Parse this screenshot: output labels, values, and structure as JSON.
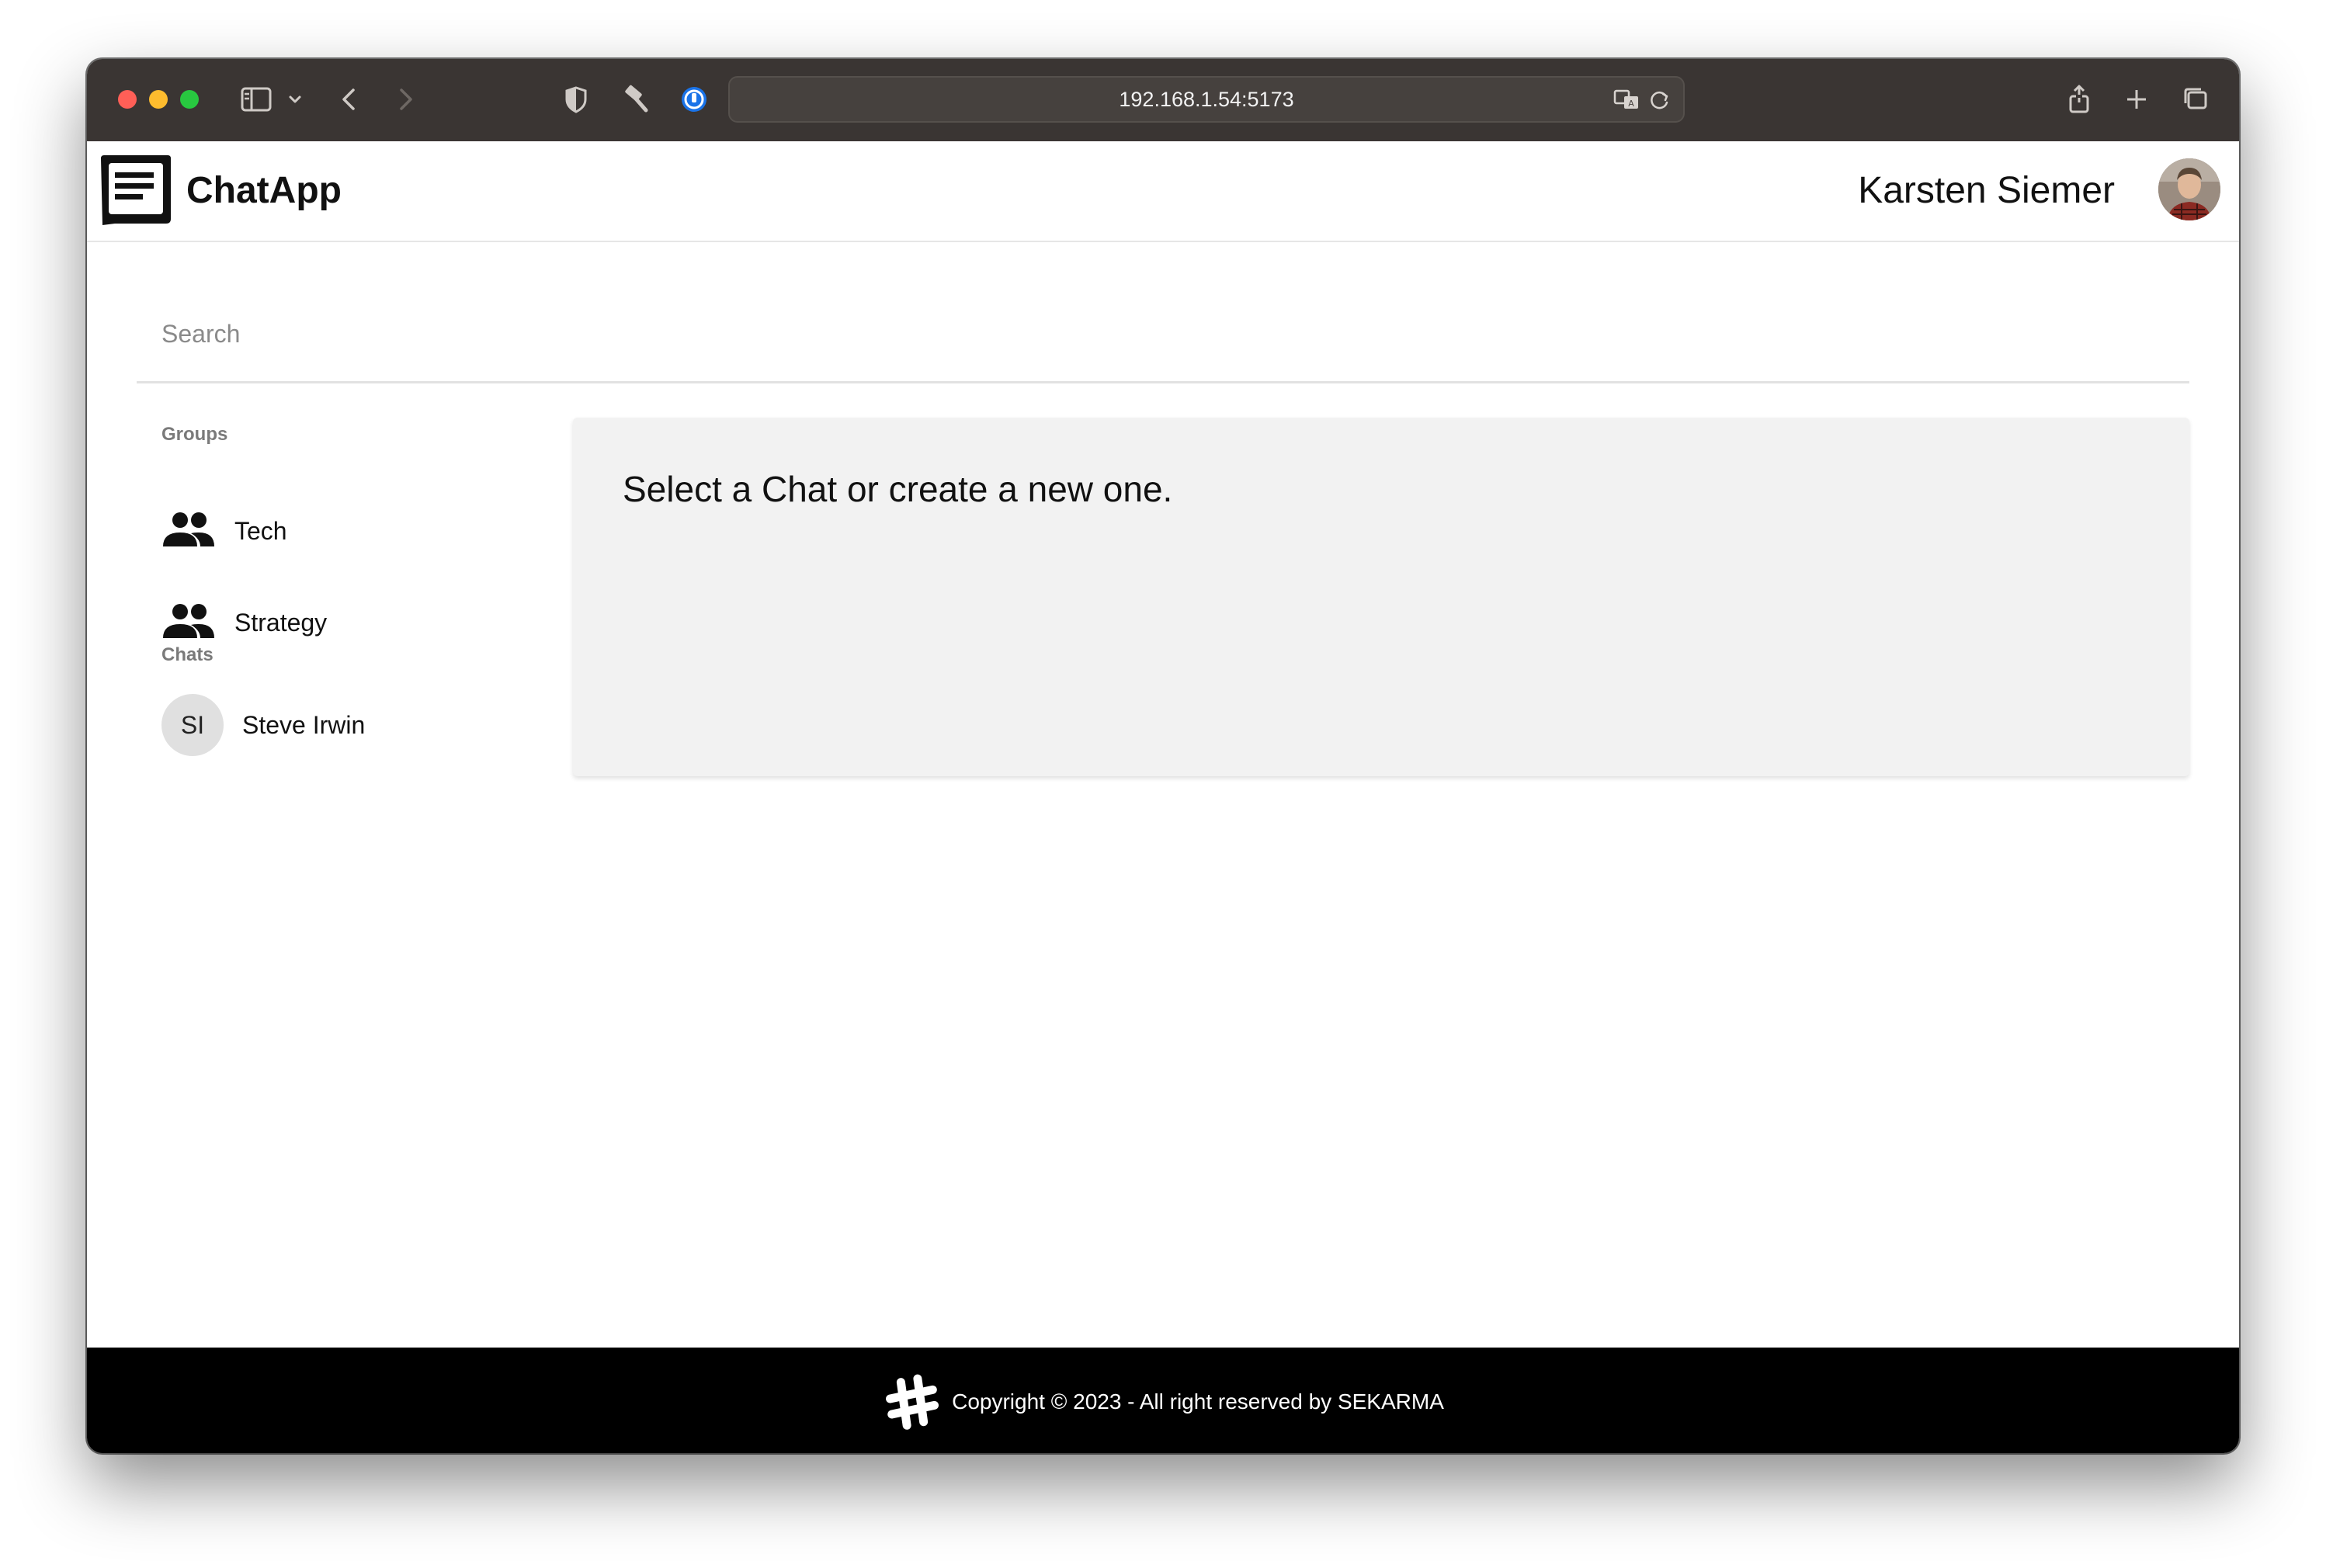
{
  "browser": {
    "url": "192.168.1.54:5173"
  },
  "app": {
    "name": "ChatApp",
    "user_name": "Karsten Siemer"
  },
  "search": {
    "placeholder": "Search",
    "value": ""
  },
  "sidebar": {
    "groups_label": "Groups",
    "groups": [
      {
        "label": "Tech",
        "icon": "group-icon"
      },
      {
        "label": "Strategy",
        "icon": "group-icon"
      }
    ],
    "chats_label": "Chats",
    "chats": [
      {
        "initials": "SI",
        "label": "Steve Irwin"
      }
    ]
  },
  "main": {
    "message": "Select a Chat or create a new one."
  },
  "footer": {
    "copyright": "Copyright © 2023 - All right reserved by SEKARMA",
    "icon": "hash-icon"
  },
  "colors": {
    "toolbar_bg": "#3a3533",
    "panel_bg": "#f2f2f2",
    "footer_bg": "#000000",
    "traffic_red": "#ff5f57",
    "traffic_yellow": "#febc2e",
    "traffic_green": "#28c840"
  }
}
